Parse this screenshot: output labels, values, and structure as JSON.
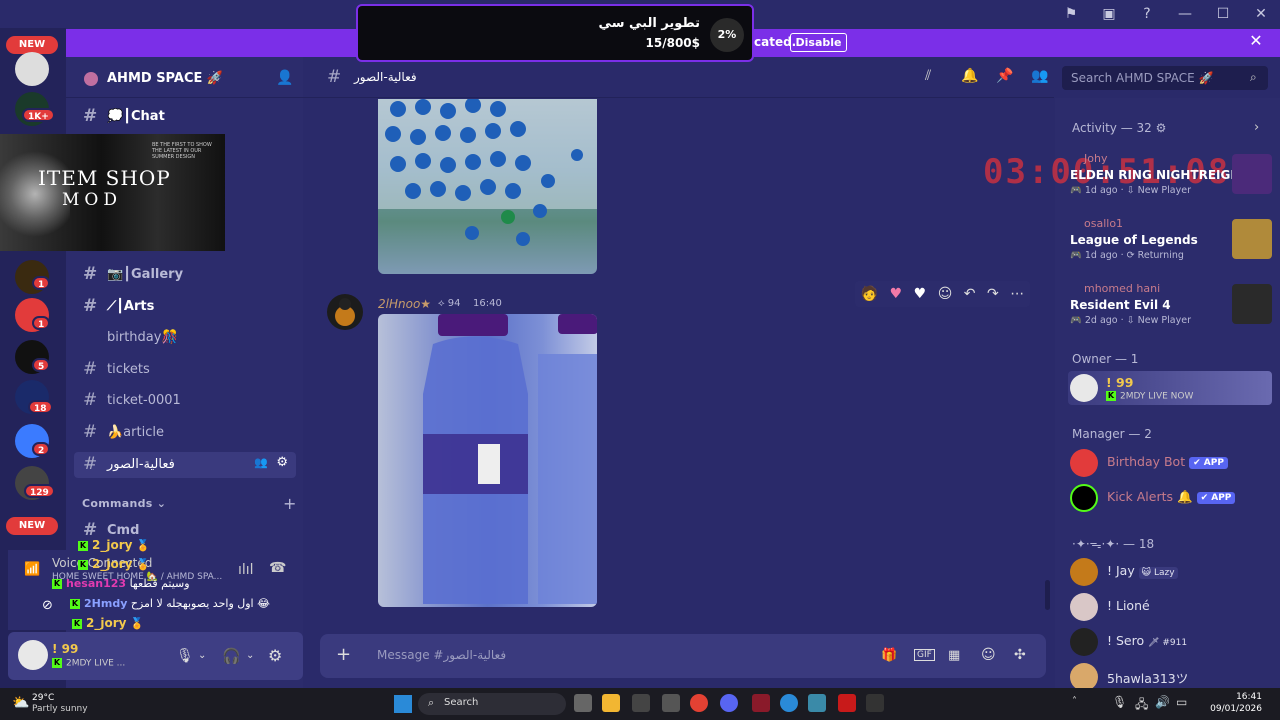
{
  "donation": {
    "title": "تطوير البي سي",
    "amount": "15/800$",
    "percent": "2%"
  },
  "notice": {
    "text": "cated.",
    "button": "Disable"
  },
  "rail": {
    "new_label": "NEW",
    "badges": [
      "1K+",
      "1",
      "1",
      "5",
      "18",
      "2",
      "129"
    ]
  },
  "server": {
    "name": "AHMD SPACE 🚀"
  },
  "channels": [
    {
      "label": "💭┃Chat"
    },
    {
      "label": "📷┃Gallery"
    },
    {
      "label": "⟋┃Arts"
    },
    {
      "label": "birthday🎊"
    },
    {
      "label": "tickets"
    },
    {
      "label": "ticket-0001"
    },
    {
      "label": "🍌article"
    },
    {
      "label": "فعالية-الصور"
    },
    {
      "label": "Cmd"
    }
  ],
  "category": {
    "commands": "Commands"
  },
  "item_shop": {
    "line1": "ITEM SHOP",
    "line2": "MOD",
    "tagline": "BE THE FIRST TO SHOW THE LATEST IN OUR SUMMER DESIGN"
  },
  "voice": {
    "status": "Voice Connected",
    "channel": "HOME SWEET HOME 🏡 / AHMD SPA...",
    "overlay_user": "2_jory",
    "overlay_lines": [
      {
        "user": "2_jory",
        "text": ""
      },
      {
        "user": "2_jory",
        "text": ""
      },
      {
        "user": "hesan123",
        "text": "وسيتم قطعها"
      },
      {
        "user": "2Hmdy",
        "text": "اول واحد يصوبهجله لا امزح 😂"
      },
      {
        "user": "2_jory",
        "text": ""
      },
      {
        "user": "2_jory",
        "text": ""
      }
    ]
  },
  "user_panel": {
    "name": "! 99",
    "status": "2MDY LIVE ..."
  },
  "chat": {
    "channel": "فعالية-الصور",
    "search_placeholder": "Search AHMD SPACE 🚀",
    "message": {
      "author": "2lHnoo★",
      "boost": "94",
      "time": "16:40"
    },
    "composer_placeholder": "Message #فعالية-الصور"
  },
  "members": {
    "activity_header": "Activity — 32",
    "activities": [
      {
        "user": "Johy",
        "game": "ELDEN RING NIGHTREIGN",
        "meta": "1d ago",
        "tag": "New Player",
        "color": "#4b2a7a"
      },
      {
        "user": "osallo1",
        "game": "League of Legends",
        "meta": "1d ago",
        "tag": "Returning",
        "color": "#b08a3a"
      },
      {
        "user": "mhomed hani",
        "game": "Resident Evil 4",
        "meta": "2d ago",
        "tag": "New Player",
        "color": "#2a2a2a"
      }
    ],
    "owner_header": "Owner — 1",
    "owner": {
      "name": "! 99",
      "status": "2MDY LIVE NOW"
    },
    "manager_header": "Manager — 2",
    "managers": [
      {
        "name": "Birthday Bot",
        "tag": "✔ APP"
      },
      {
        "name": "Kick Alerts 🔔",
        "tag": "✔ APP"
      }
    ],
    "group_header": "·✦·ᯓ·✦· — 18",
    "group_members": [
      {
        "name": "! Jay",
        "extra": "😺 Lazy"
      },
      {
        "name": "! Lioné",
        "extra": ""
      },
      {
        "name": "! Sero",
        "extra": "🗡 #911"
      },
      {
        "name": "5hawla313ツ",
        "extra": ""
      }
    ],
    "timer": "03:00:51:08"
  },
  "taskbar": {
    "weather_temp": "29°C",
    "weather_desc": "Partly sunny",
    "search": "Search",
    "time": "16:41",
    "date": "09/01/2026"
  }
}
